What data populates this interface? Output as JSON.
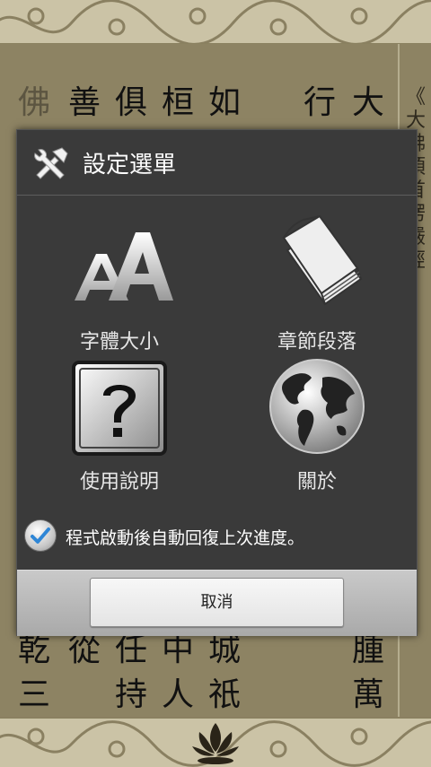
{
  "background": {
    "columns": [
      {
        "text": "佛林",
        "faded": true
      },
      {
        "text": "善根",
        "faded": false
      },
      {
        "text": "俱情",
        "faded": false
      },
      {
        "text": "桓博",
        "faded": false
      },
      {
        "text": "如是",
        "faded": false
      },
      {
        "text": "",
        "faded": false
      },
      {
        "text": "行前",
        "faded": false
      },
      {
        "text": "大佛",
        "faded": false
      }
    ],
    "bottom_rows": [
      {
        "text": "乾三"
      },
      {
        "text": "從"
      },
      {
        "text": "任持"
      },
      {
        "text": "中人"
      },
      {
        "text": "城祇"
      },
      {
        "text": ""
      },
      {
        "text": ""
      },
      {
        "text": "腫萬"
      }
    ],
    "side_title": "《大佛頂首楞嚴經》"
  },
  "dialog": {
    "title": "設定選單",
    "items": [
      {
        "label": "字體大小",
        "icon": "font-size-icon"
      },
      {
        "label": "章節段落",
        "icon": "book-icon"
      },
      {
        "label": "使用說明",
        "icon": "help-icon"
      },
      {
        "label": "關於",
        "icon": "globe-icon"
      }
    ],
    "checkbox": {
      "label": "程式啟動後自動回復上次進度。",
      "checked": true
    },
    "cancel_label": "取消"
  }
}
